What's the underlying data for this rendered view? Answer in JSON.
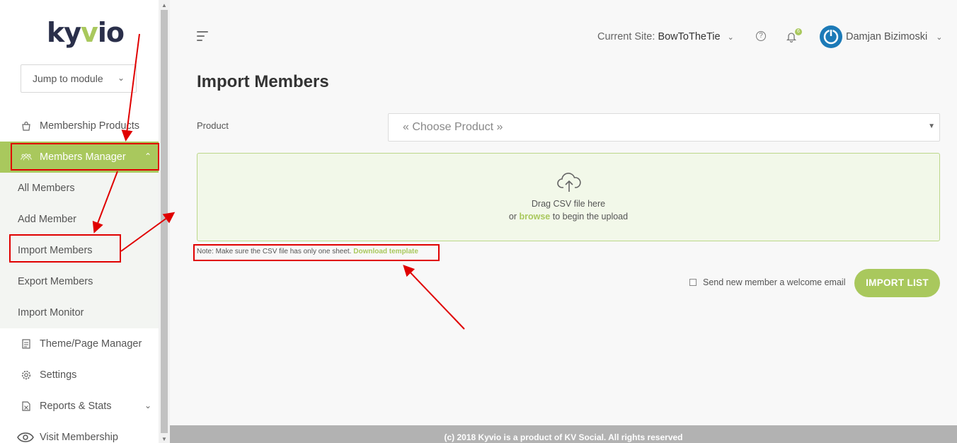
{
  "sidebar": {
    "logo": {
      "pre": "ky",
      "accent": "v",
      "post": "io"
    },
    "jump_label": "Jump to module",
    "items": [
      {
        "label": "Membership Products",
        "icon": "bag-icon"
      },
      {
        "label": "Members Manager",
        "icon": "users-icon"
      },
      {
        "label": "Theme/Page Manager",
        "icon": "page-icon"
      },
      {
        "label": "Settings",
        "icon": "gear-icon"
      },
      {
        "label": "Reports & Stats",
        "icon": "spreadsheet-icon"
      },
      {
        "label": "Visit Membership",
        "icon": "eye-icon"
      }
    ],
    "sub_items": [
      {
        "label": "All Members"
      },
      {
        "label": "Add Member"
      },
      {
        "label": "Import Members"
      },
      {
        "label": "Export Members"
      },
      {
        "label": "Import Monitor"
      }
    ]
  },
  "header": {
    "site_label": "Current Site:",
    "site_name": "BowToTheTie",
    "notifications_count": "6",
    "user_name": "Damjan Bizimoski"
  },
  "main": {
    "title": "Import Members",
    "product_label": "Product",
    "product_placeholder": "« Choose Product »",
    "drop_line1": "Drag CSV file here",
    "drop_or": "or ",
    "drop_browse": "browse",
    "drop_tail": " to begin the upload",
    "note_text": "Note: Make sure the CSV file has only one sheet. ",
    "download_link": "Download template",
    "welcome_label": "Send new member a welcome email",
    "import_button": "IMPORT LIST"
  },
  "footer": {
    "text": "(c) 2018 Kyvio is a product of KV Social. All rights reserved"
  },
  "colors": {
    "accent": "#a9c85d",
    "annotation": "#e00000"
  }
}
